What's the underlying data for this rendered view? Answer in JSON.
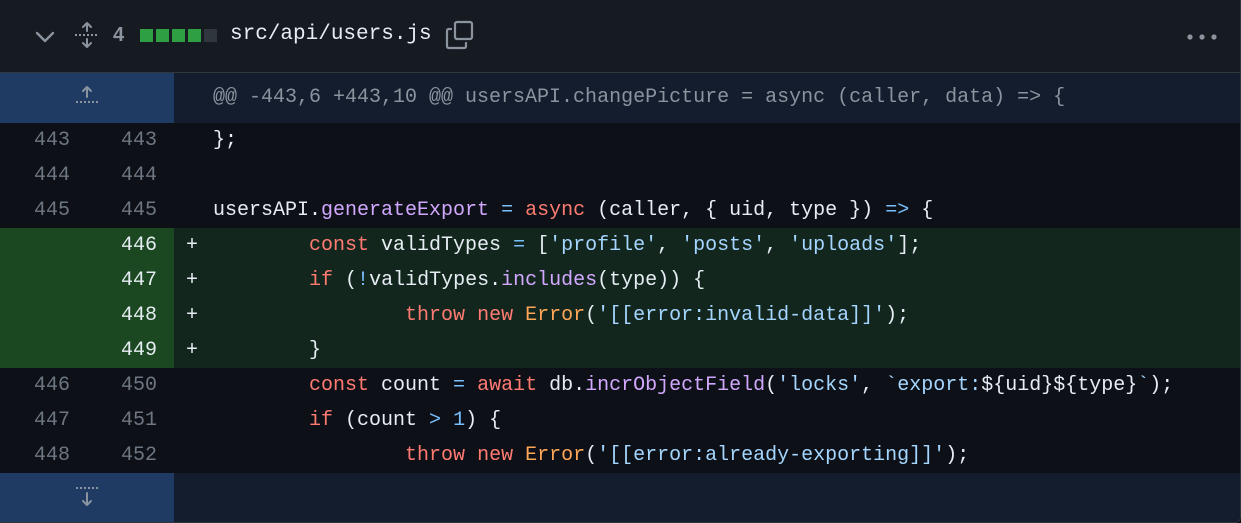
{
  "file": {
    "changed_lines": "4",
    "path": "src/api/users.js",
    "diffstat": [
      "#2ea043",
      "#2ea043",
      "#2ea043",
      "#2ea043",
      "#30363d"
    ]
  },
  "icons": {
    "collapse": "chevron-down-icon",
    "expand_all": "unfold-icon",
    "copy": "copy-icon",
    "more": "kebab-horizontal-icon",
    "expand_up": "fold-up-icon",
    "expand_down": "fold-down-icon"
  },
  "hunk_header": "@@ -443,6 +443,10 @@ usersAPI.changePicture = async (caller, data) => {",
  "lines": [
    {
      "old": "443",
      "new": "443",
      "sign": "",
      "type": "ctx"
    },
    {
      "old": "444",
      "new": "444",
      "sign": "",
      "type": "ctx"
    },
    {
      "old": "445",
      "new": "445",
      "sign": "",
      "type": "ctx"
    },
    {
      "old": "",
      "new": "446",
      "sign": "+",
      "type": "add"
    },
    {
      "old": "",
      "new": "447",
      "sign": "+",
      "type": "add"
    },
    {
      "old": "",
      "new": "448",
      "sign": "+",
      "type": "add"
    },
    {
      "old": "",
      "new": "449",
      "sign": "+",
      "type": "add"
    },
    {
      "old": "446",
      "new": "450",
      "sign": "",
      "type": "ctx"
    },
    {
      "old": "447",
      "new": "451",
      "sign": "",
      "type": "ctx"
    },
    {
      "old": "448",
      "new": "452",
      "sign": "",
      "type": "ctx"
    }
  ],
  "code": {
    "l0": "};",
    "l2": {
      "a": "usersAPI.",
      "b": "generateExport",
      "c": " ",
      "d": "=",
      "e": " ",
      "f": "async",
      "g": " (caller, { uid, type }) ",
      "h": "=>",
      "i": " {"
    },
    "l3": {
      "a": "        ",
      "b": "const",
      "c": " validTypes ",
      "d": "=",
      "e": " [",
      "f": "'profile'",
      "g": ", ",
      "h": "'posts'",
      "i": ", ",
      "j": "'uploads'",
      "k": "];"
    },
    "l4": {
      "a": "        ",
      "b": "if",
      "c": " (",
      "d": "!",
      "e": "validTypes.",
      "f": "includes",
      "g": "(type)) {"
    },
    "l5": {
      "a": "                ",
      "b": "throw",
      "c": " ",
      "d": "new",
      "e": " ",
      "f": "Error",
      "g": "(",
      "h": "'[[error:invalid-data]]'",
      "i": ");"
    },
    "l6": {
      "a": "        }"
    },
    "l7": {
      "a": "        ",
      "b": "const",
      "c": " count ",
      "d": "=",
      "e": " ",
      "f": "await",
      "g": " db.",
      "h": "incrObjectField",
      "i": "(",
      "j": "'locks'",
      "k": ", ",
      "l": "`export:",
      "m": "${uid}${type}",
      "n": "`",
      "o": ");"
    },
    "l8": {
      "a": "        ",
      "b": "if",
      "c": " (count ",
      "d": ">",
      "e": " ",
      "f": "1",
      "g": ") {"
    },
    "l9": {
      "a": "                ",
      "b": "throw",
      "c": " ",
      "d": "new",
      "e": " ",
      "f": "Error",
      "g": "(",
      "h": "'[[error:already-exporting]]'",
      "i": ");"
    }
  }
}
